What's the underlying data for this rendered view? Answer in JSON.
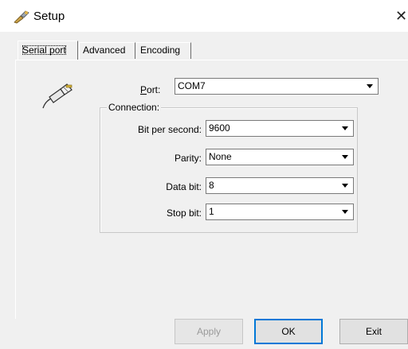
{
  "window": {
    "title": "Setup",
    "close_glyph": "✕"
  },
  "tabs": [
    {
      "label": "Serial port",
      "active": true
    },
    {
      "label": "Advanced",
      "active": false
    },
    {
      "label": "Encoding",
      "active": false
    }
  ],
  "port": {
    "label": "Port:",
    "value": "COM7"
  },
  "connection": {
    "legend": "Connection:",
    "bit_per_second": {
      "label": "Bit per second:",
      "value": "9600"
    },
    "parity": {
      "label": "Parity:",
      "value": "None"
    },
    "data_bit": {
      "label": "Data bit:",
      "value": "8"
    },
    "stop_bit": {
      "label": "Stop bit:",
      "value": "1"
    }
  },
  "buttons": {
    "apply": {
      "label": "Apply",
      "enabled": false
    },
    "ok": {
      "label": "OK",
      "default": true
    },
    "exit": {
      "label": "Exit"
    }
  },
  "icons": {
    "app": "setup-tool-icon",
    "port": "serial-plug-icon"
  },
  "colors": {
    "focus_border": "#0078d7",
    "dialog_bg": "#f0f0f0"
  }
}
